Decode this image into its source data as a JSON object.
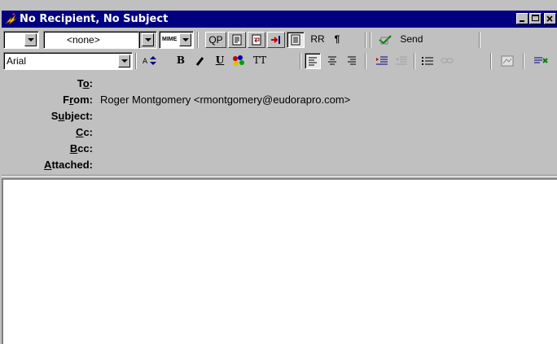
{
  "window": {
    "title": "No Recipient, No Subject",
    "icon": "flying-envelope-icon"
  },
  "toolbar1": {
    "priority_value": "",
    "signature_value": "<none>",
    "encoding_value": "MIME",
    "qp_label": "QP",
    "rr_label": "RR",
    "pilcrow_label": "¶",
    "send_label": "Send"
  },
  "toolbar2": {
    "font_value": "Arial",
    "bold_label": "B",
    "underline_label": "U",
    "tt_label": "TT"
  },
  "headers": {
    "to": {
      "pre": "T",
      "key": "o",
      "post": ":",
      "value": ""
    },
    "from": {
      "pre": "F",
      "key": "r",
      "post": "om:",
      "value": "Roger Montgomery <rmontgomery@eudorapro.com>"
    },
    "subject": {
      "pre": "S",
      "key": "u",
      "post": "bject:",
      "value": ""
    },
    "cc": {
      "pre": "",
      "key": "C",
      "post": "c:",
      "value": ""
    },
    "bcc": {
      "pre": "",
      "key": "B",
      "post": "cc:",
      "value": ""
    },
    "attached": {
      "pre": "",
      "key": "A",
      "post": "ttached:",
      "value": ""
    }
  },
  "colors": {
    "titlebar": "#000080",
    "face": "#c0c0c0"
  }
}
